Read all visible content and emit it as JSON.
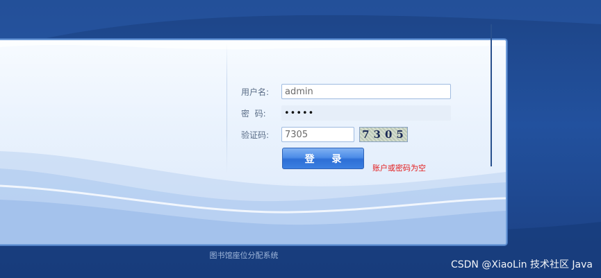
{
  "form": {
    "username_label": "用户名:",
    "username_value": "admin",
    "password_label": "密  码:",
    "password_value": "•••••",
    "captcha_label": "验证码:",
    "captcha_value": "7305",
    "captcha_image_text": "7305",
    "login_label": "登 录",
    "error_message": "账户或密码为空"
  },
  "footer": {
    "system_name": "图书馆座位分配系统"
  },
  "watermark": {
    "text": "CSDN @XiaoLin 技术社区 Java"
  },
  "colors": {
    "background": "#1e4a93",
    "panel": "#e9f2fd",
    "button": "#4d8de8",
    "error": "#e31b1b"
  }
}
